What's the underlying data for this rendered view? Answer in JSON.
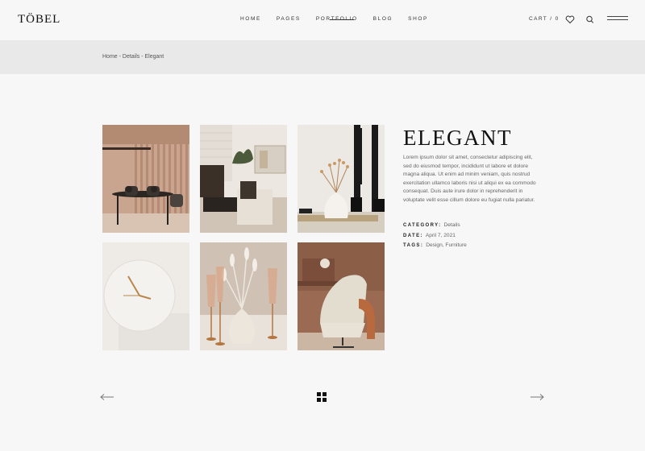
{
  "header": {
    "logo": "TÖBEL",
    "nav": [
      "HOME",
      "PAGES",
      "PORTFOLIO",
      "BLOG",
      "SHOP"
    ],
    "cart_label": "CART / 0"
  },
  "breadcrumb": {
    "text": "Home - Details - Elegant"
  },
  "gallery": {
    "images": [
      "dining-room-image",
      "living-room-image",
      "vase-flowers-image",
      "wall-clock-image",
      "table-vase-glasses-image",
      "armchair-corner-image"
    ]
  },
  "project": {
    "title": "ELEGANT",
    "description": "Lorem ipsum dolor sit amet, consectetur adipiscing elit, sed do eiusmod tempor, incididunt ut labore et dolore magna aliqua. Ut enim ad minim veniam, quis nostrud exercitation ullamco laboris nisi ut aliqui ex ea commodo consequat. Duis aute irure dolor in reprehenderit in voluptate velit esse cillum dolore eu fugiat nulla pariatur.",
    "category_label": "CATEGORY:",
    "category_value": "Details",
    "date_label": "DATE:",
    "date_value": "April 7, 2021",
    "tags_label": "TAGS:",
    "tags_value": "Design, Furniture"
  },
  "icons": {
    "wishlist": "heart-icon",
    "search": "search-icon",
    "menu": "hamburger-icon",
    "prev": "arrow-left-icon",
    "next": "arrow-right-icon",
    "grid": "grid-icon"
  }
}
